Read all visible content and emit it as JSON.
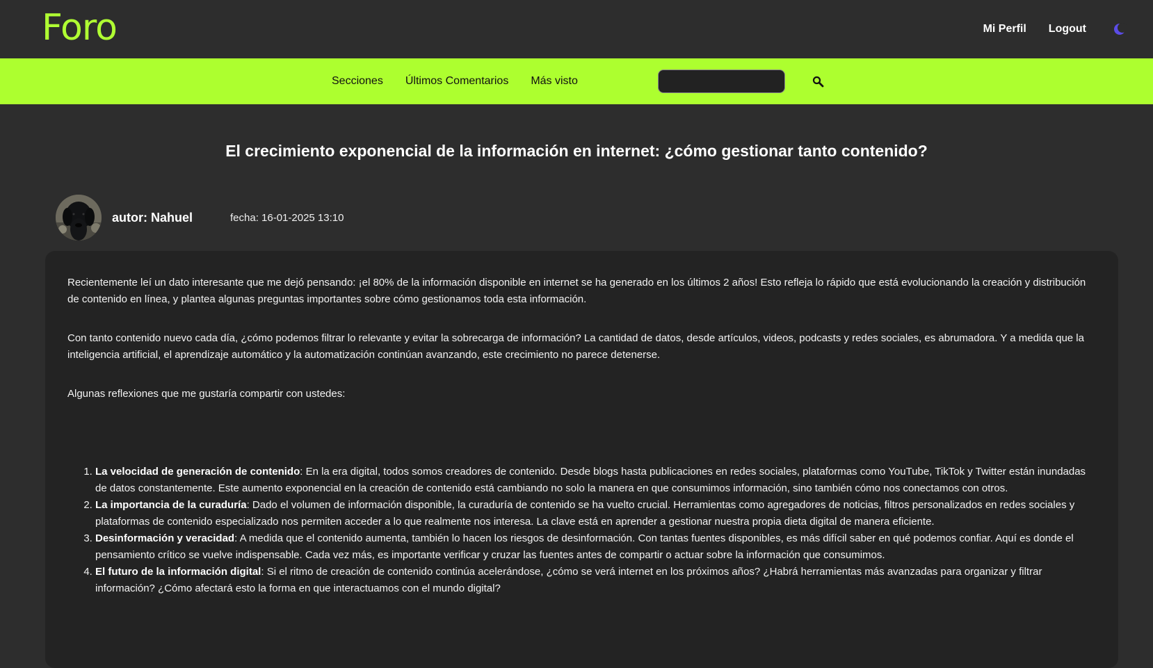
{
  "header": {
    "logo": "Foro",
    "links": {
      "profile": "Mi Perfil",
      "logout": "Logout"
    }
  },
  "nav": {
    "items": [
      "Secciones",
      "Últimos Comentarios",
      "Más visto"
    ],
    "search_placeholder": ""
  },
  "post": {
    "title": "El crecimiento exponencial de la información en internet: ¿cómo gestionar tanto contenido?",
    "author": "autor: Nahuel",
    "date": "fecha: 16-01-2025 13:10",
    "paragraphs": [
      "Recientemente leí un dato interesante que me dejó pensando: ¡el 80% de la información disponible en internet se ha generado en los últimos 2 años! Esto refleja lo rápido que está evolucionando la creación y distribución de contenido en línea, y plantea algunas preguntas importantes sobre cómo gestionamos toda esta información.",
      "Con tanto contenido nuevo cada día, ¿cómo podemos filtrar lo relevante y evitar la sobrecarga de información? La cantidad de datos, desde artículos, videos, podcasts y redes sociales, es abrumadora. Y a medida que la inteligencia artificial, el aprendizaje automático y la automatización continúan avanzando, este crecimiento no parece detenerse.",
      "Algunas reflexiones que me gustaría compartir con ustedes:"
    ],
    "list": [
      {
        "title": "La velocidad de generación de contenido",
        "text": ": En la era digital, todos somos creadores de contenido. Desde blogs hasta publicaciones en redes sociales, plataformas como YouTube, TikTok y Twitter están inundadas de datos constantemente. Este aumento exponencial en la creación de contenido está cambiando no solo la manera en que consumimos información, sino también cómo nos conectamos con otros."
      },
      {
        "title": "La importancia de la curaduría",
        "text": ": Dado el volumen de información disponible, la curaduría de contenido se ha vuelto crucial. Herramientas como agregadores de noticias, filtros personalizados en redes sociales y plataformas de contenido especializado nos permiten acceder a lo que realmente nos interesa. La clave está en aprender a gestionar nuestra propia dieta digital de manera eficiente."
      },
      {
        "title": "Desinformación y veracidad",
        "text": ": A medida que el contenido aumenta, también lo hacen los riesgos de desinformación. Con tantas fuentes disponibles, es más difícil saber en qué podemos confiar. Aquí es donde el pensamiento crítico se vuelve indispensable. Cada vez más, es importante verificar y cruzar las fuentes antes de compartir o actuar sobre la información que consumimos."
      },
      {
        "title": "El futuro de la información digital",
        "text": ": Si el ritmo de creación de contenido continúa acelerándose, ¿cómo se verá internet en los próximos años? ¿Habrá herramientas más avanzadas para organizar y filtrar información? ¿Cómo afectará esto la forma en que interactuamos con el mundo digital?"
      }
    ]
  },
  "colors": {
    "accent": "#adff2f",
    "logo": "#b0ff33",
    "background": "#2d2d2d",
    "card": "#232323",
    "moon": "#5b4ce6"
  },
  "icons": {
    "search": "search-icon",
    "theme": "moon-icon"
  }
}
